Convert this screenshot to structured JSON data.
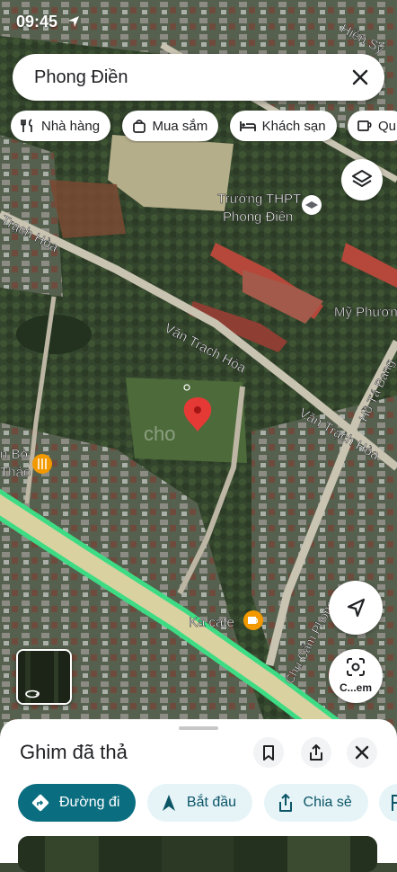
{
  "status_bar": {
    "time": "09:45"
  },
  "search": {
    "query": "Phong Điền"
  },
  "chips": [
    {
      "label": "Nhà hàng",
      "icon": "restaurant-icon"
    },
    {
      "label": "Mua sắm",
      "icon": "shopping-bag-icon"
    },
    {
      "label": "Khách sạn",
      "icon": "hotel-icon"
    },
    {
      "label": "Qu",
      "icon": "cafe-cup-icon"
    }
  ],
  "map_labels": {
    "top_street": "Hiền Sỹ",
    "school_line1": "Trường THPT",
    "school_line2": "Phong Điền",
    "road_west": "Trạch Hòa",
    "road_mid": "Văn Trạch Hòa",
    "road_east": "Văn Trạch Hòa",
    "ho_ta_bang": "Hồ Tá Bang",
    "my_phuong": "Mỹ Phươn",
    "bo_line1": "n Bò",
    "bo_line2": "Thảo",
    "watermark": "cho",
    "ka_cafe": "Ka cafe",
    "chu_cam_phong": "Chu Cẩm Phong"
  },
  "lens_button_label": "C...em",
  "sheet": {
    "title": "Ghim đã thả",
    "actions": [
      {
        "label": "Đường đi",
        "icon": "directions-icon"
      },
      {
        "label": "Bắt đầu",
        "icon": "navigation-arrow-icon"
      },
      {
        "label": "Chia sẻ",
        "icon": "share-icon"
      }
    ]
  },
  "colors": {
    "accent": "#0b6e80",
    "pin": "#e53935",
    "highway": "#3ddc84",
    "action_bg": "#e6f4f8"
  }
}
